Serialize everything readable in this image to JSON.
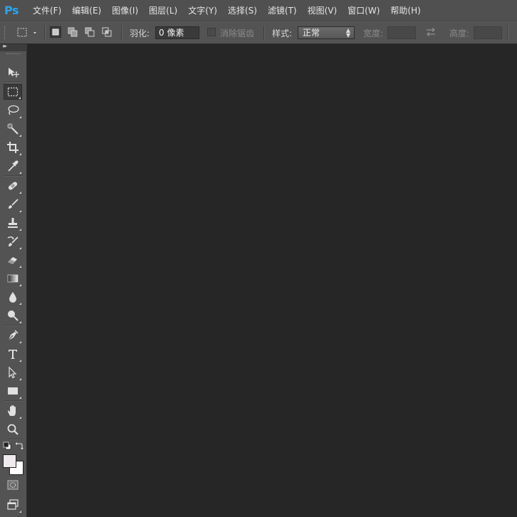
{
  "app": {
    "logo": "Ps"
  },
  "menu": [
    {
      "label": "文件(F)"
    },
    {
      "label": "编辑(E)"
    },
    {
      "label": "图像(I)"
    },
    {
      "label": "图层(L)"
    },
    {
      "label": "文字(Y)"
    },
    {
      "label": "选择(S)"
    },
    {
      "label": "滤镜(T)"
    },
    {
      "label": "视图(V)"
    },
    {
      "label": "窗口(W)"
    },
    {
      "label": "帮助(H)"
    }
  ],
  "options": {
    "feather_label": "羽化:",
    "feather_value": "0 像素",
    "antialias_label": "消除锯齿",
    "style_label": "样式:",
    "style_value": "正常",
    "width_label": "宽度:",
    "width_value": "",
    "height_label": "高度:",
    "height_value": ""
  },
  "tools": [
    {
      "name": "move-tool-icon"
    },
    {
      "name": "rectangular-marquee-tool-icon",
      "active": true
    },
    {
      "name": "lasso-tool-icon"
    },
    {
      "name": "magic-wand-tool-icon"
    },
    {
      "name": "crop-tool-icon"
    },
    {
      "name": "eyedropper-tool-icon"
    },
    {
      "name": "spot-healing-brush-tool-icon"
    },
    {
      "name": "brush-tool-icon"
    },
    {
      "name": "clone-stamp-tool-icon"
    },
    {
      "name": "history-brush-tool-icon"
    },
    {
      "name": "eraser-tool-icon"
    },
    {
      "name": "gradient-tool-icon"
    },
    {
      "name": "blur-tool-icon"
    },
    {
      "name": "dodge-tool-icon"
    },
    {
      "name": "pen-tool-icon"
    },
    {
      "name": "type-tool-icon"
    },
    {
      "name": "path-selection-tool-icon"
    },
    {
      "name": "rectangle-shape-tool-icon"
    },
    {
      "name": "hand-tool-icon"
    },
    {
      "name": "zoom-tool-icon"
    }
  ],
  "colors": {
    "foreground": "#eeeaee",
    "background": "#ffffff",
    "accent": "#2fa3e8"
  }
}
